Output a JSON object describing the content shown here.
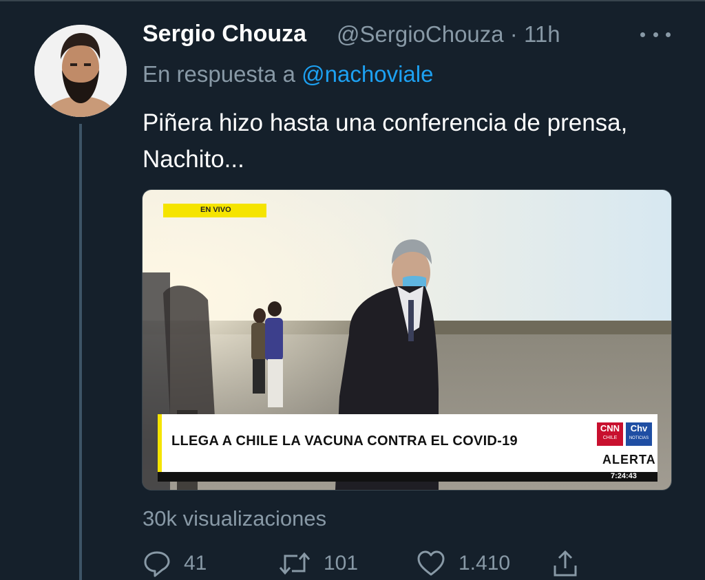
{
  "tweet": {
    "author_name": "Sergio Chouza",
    "handle_time": "@SergioChouza · 11h",
    "reply_prefix": "En respuesta a",
    "reply_mention": "@nachoviale",
    "text": "Piñera hizo hasta una conferencia de prensa, Nachito...",
    "views": "30k visualizaciones"
  },
  "video": {
    "live_badge": "EN VIVO",
    "lower_third": "LLEGA A CHILE LA VACUNA CONTRA EL COVID-19",
    "logo_cnn": "CNN",
    "logo_cnn_sub": "CHILE",
    "logo_chv": "Chv",
    "logo_chv_sub": "NOTICIAS",
    "alert": "ALERTA",
    "clock": "7:24:43"
  },
  "actions": {
    "replies": "41",
    "retweets": "101",
    "likes": "1.410"
  },
  "colors": {
    "background": "#15202b",
    "secondary_text": "#8899a6",
    "link": "#1da1f2",
    "live_badge": "#f5e400"
  },
  "icons": [
    "more-icon",
    "reply-icon",
    "retweet-icon",
    "like-icon",
    "share-icon"
  ]
}
